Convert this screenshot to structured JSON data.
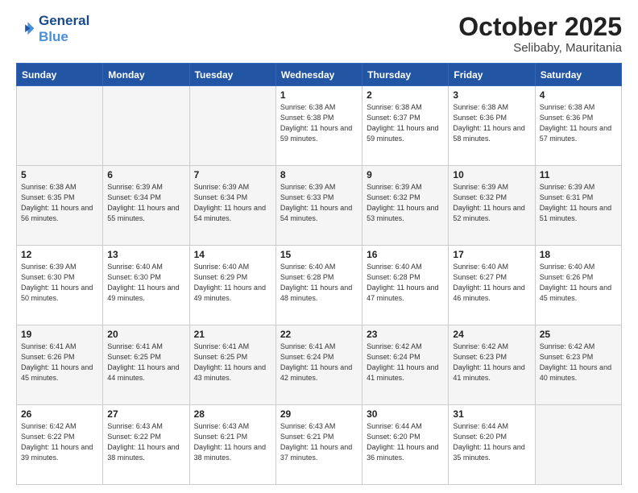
{
  "header": {
    "logo_line1": "General",
    "logo_line2": "Blue",
    "month": "October 2025",
    "location": "Selibaby, Mauritania"
  },
  "days_of_week": [
    "Sunday",
    "Monday",
    "Tuesday",
    "Wednesday",
    "Thursday",
    "Friday",
    "Saturday"
  ],
  "weeks": [
    [
      {
        "day": "",
        "empty": true
      },
      {
        "day": "",
        "empty": true
      },
      {
        "day": "",
        "empty": true
      },
      {
        "day": "1",
        "sunrise": "6:38 AM",
        "sunset": "6:38 PM",
        "daylight": "11 hours and 59 minutes."
      },
      {
        "day": "2",
        "sunrise": "6:38 AM",
        "sunset": "6:37 PM",
        "daylight": "11 hours and 59 minutes."
      },
      {
        "day": "3",
        "sunrise": "6:38 AM",
        "sunset": "6:36 PM",
        "daylight": "11 hours and 58 minutes."
      },
      {
        "day": "4",
        "sunrise": "6:38 AM",
        "sunset": "6:36 PM",
        "daylight": "11 hours and 57 minutes."
      }
    ],
    [
      {
        "day": "5",
        "sunrise": "6:38 AM",
        "sunset": "6:35 PM",
        "daylight": "11 hours and 56 minutes."
      },
      {
        "day": "6",
        "sunrise": "6:39 AM",
        "sunset": "6:34 PM",
        "daylight": "11 hours and 55 minutes."
      },
      {
        "day": "7",
        "sunrise": "6:39 AM",
        "sunset": "6:34 PM",
        "daylight": "11 hours and 54 minutes."
      },
      {
        "day": "8",
        "sunrise": "6:39 AM",
        "sunset": "6:33 PM",
        "daylight": "11 hours and 54 minutes."
      },
      {
        "day": "9",
        "sunrise": "6:39 AM",
        "sunset": "6:32 PM",
        "daylight": "11 hours and 53 minutes."
      },
      {
        "day": "10",
        "sunrise": "6:39 AM",
        "sunset": "6:32 PM",
        "daylight": "11 hours and 52 minutes."
      },
      {
        "day": "11",
        "sunrise": "6:39 AM",
        "sunset": "6:31 PM",
        "daylight": "11 hours and 51 minutes."
      }
    ],
    [
      {
        "day": "12",
        "sunrise": "6:39 AM",
        "sunset": "6:30 PM",
        "daylight": "11 hours and 50 minutes."
      },
      {
        "day": "13",
        "sunrise": "6:40 AM",
        "sunset": "6:30 PM",
        "daylight": "11 hours and 49 minutes."
      },
      {
        "day": "14",
        "sunrise": "6:40 AM",
        "sunset": "6:29 PM",
        "daylight": "11 hours and 49 minutes."
      },
      {
        "day": "15",
        "sunrise": "6:40 AM",
        "sunset": "6:28 PM",
        "daylight": "11 hours and 48 minutes."
      },
      {
        "day": "16",
        "sunrise": "6:40 AM",
        "sunset": "6:28 PM",
        "daylight": "11 hours and 47 minutes."
      },
      {
        "day": "17",
        "sunrise": "6:40 AM",
        "sunset": "6:27 PM",
        "daylight": "11 hours and 46 minutes."
      },
      {
        "day": "18",
        "sunrise": "6:40 AM",
        "sunset": "6:26 PM",
        "daylight": "11 hours and 45 minutes."
      }
    ],
    [
      {
        "day": "19",
        "sunrise": "6:41 AM",
        "sunset": "6:26 PM",
        "daylight": "11 hours and 45 minutes."
      },
      {
        "day": "20",
        "sunrise": "6:41 AM",
        "sunset": "6:25 PM",
        "daylight": "11 hours and 44 minutes."
      },
      {
        "day": "21",
        "sunrise": "6:41 AM",
        "sunset": "6:25 PM",
        "daylight": "11 hours and 43 minutes."
      },
      {
        "day": "22",
        "sunrise": "6:41 AM",
        "sunset": "6:24 PM",
        "daylight": "11 hours and 42 minutes."
      },
      {
        "day": "23",
        "sunrise": "6:42 AM",
        "sunset": "6:24 PM",
        "daylight": "11 hours and 41 minutes."
      },
      {
        "day": "24",
        "sunrise": "6:42 AM",
        "sunset": "6:23 PM",
        "daylight": "11 hours and 41 minutes."
      },
      {
        "day": "25",
        "sunrise": "6:42 AM",
        "sunset": "6:23 PM",
        "daylight": "11 hours and 40 minutes."
      }
    ],
    [
      {
        "day": "26",
        "sunrise": "6:42 AM",
        "sunset": "6:22 PM",
        "daylight": "11 hours and 39 minutes."
      },
      {
        "day": "27",
        "sunrise": "6:43 AM",
        "sunset": "6:22 PM",
        "daylight": "11 hours and 38 minutes."
      },
      {
        "day": "28",
        "sunrise": "6:43 AM",
        "sunset": "6:21 PM",
        "daylight": "11 hours and 38 minutes."
      },
      {
        "day": "29",
        "sunrise": "6:43 AM",
        "sunset": "6:21 PM",
        "daylight": "11 hours and 37 minutes."
      },
      {
        "day": "30",
        "sunrise": "6:44 AM",
        "sunset": "6:20 PM",
        "daylight": "11 hours and 36 minutes."
      },
      {
        "day": "31",
        "sunrise": "6:44 AM",
        "sunset": "6:20 PM",
        "daylight": "11 hours and 35 minutes."
      },
      {
        "day": "",
        "empty": true
      }
    ]
  ]
}
